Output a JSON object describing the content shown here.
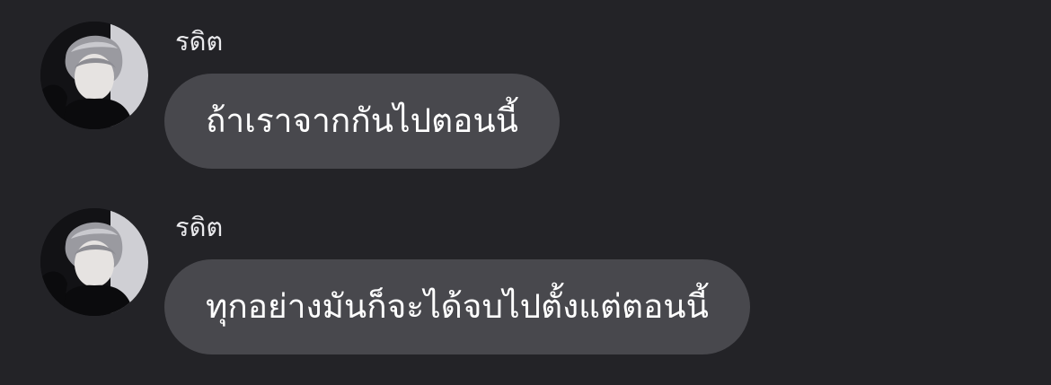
{
  "colors": {
    "background": "#232327",
    "bubble": "#48484d",
    "text": "#ffffff",
    "sender_text": "#e9e9ec"
  },
  "messages": [
    {
      "sender": "รดิต",
      "avatar_icon": "user-avatar",
      "text": "ถ้าเราจากกันไปตอนนี้"
    },
    {
      "sender": "รดิต",
      "avatar_icon": "user-avatar",
      "text": "ทุกอย่างมันก็จะได้จบไปตั้งแต่ตอนนี้"
    }
  ]
}
